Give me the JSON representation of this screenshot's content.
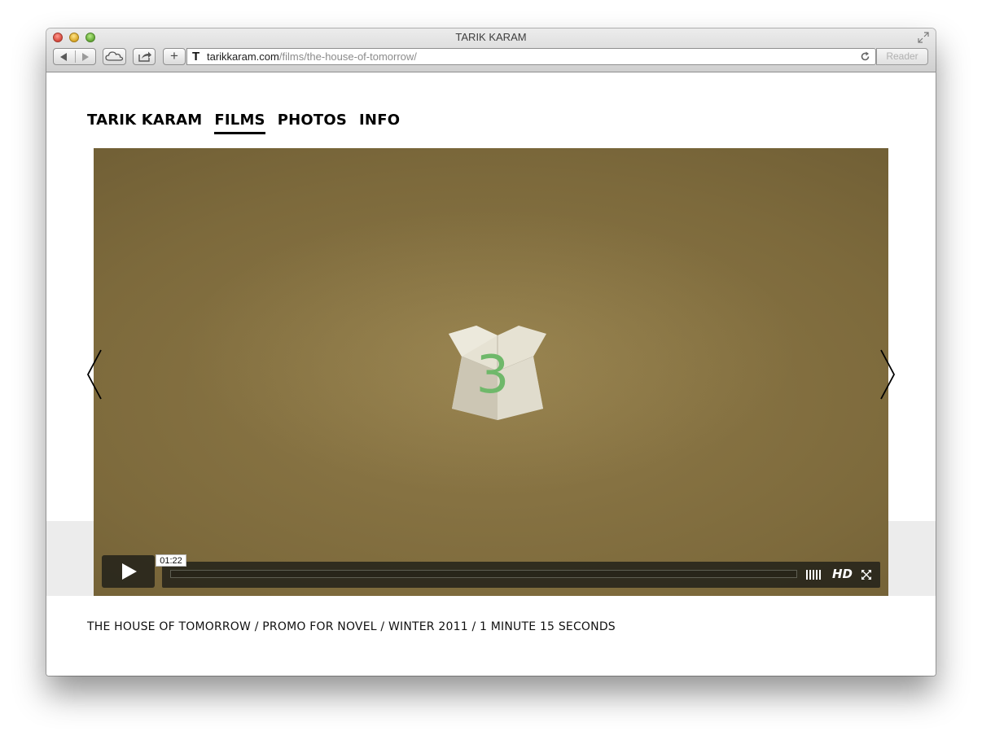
{
  "window": {
    "title": "TARIK KARAM"
  },
  "toolbar": {
    "add_label": "+",
    "url_domain": "tarikkaram.com",
    "url_path": "/films/the-house-of-tomorrow/",
    "favicon": "T",
    "reader_label": "Reader"
  },
  "nav": {
    "items": [
      {
        "label": "TARIK KARAM"
      },
      {
        "label": "FILMS"
      },
      {
        "label": "PHOTOS"
      },
      {
        "label": "INFO"
      }
    ],
    "active": "FILMS"
  },
  "video": {
    "frame_digit": "3",
    "time_tooltip": "01:22",
    "hd_label": "HD",
    "progress": 0
  },
  "caption": "THE HOUSE OF TOMORROW / PROMO FOR NOVEL / WINTER 2011 / 1 MINUTE 15 SECONDS",
  "colors": {
    "accent": "#000000",
    "video_bg": "#8f7a48",
    "digit": "#6fb86a"
  }
}
